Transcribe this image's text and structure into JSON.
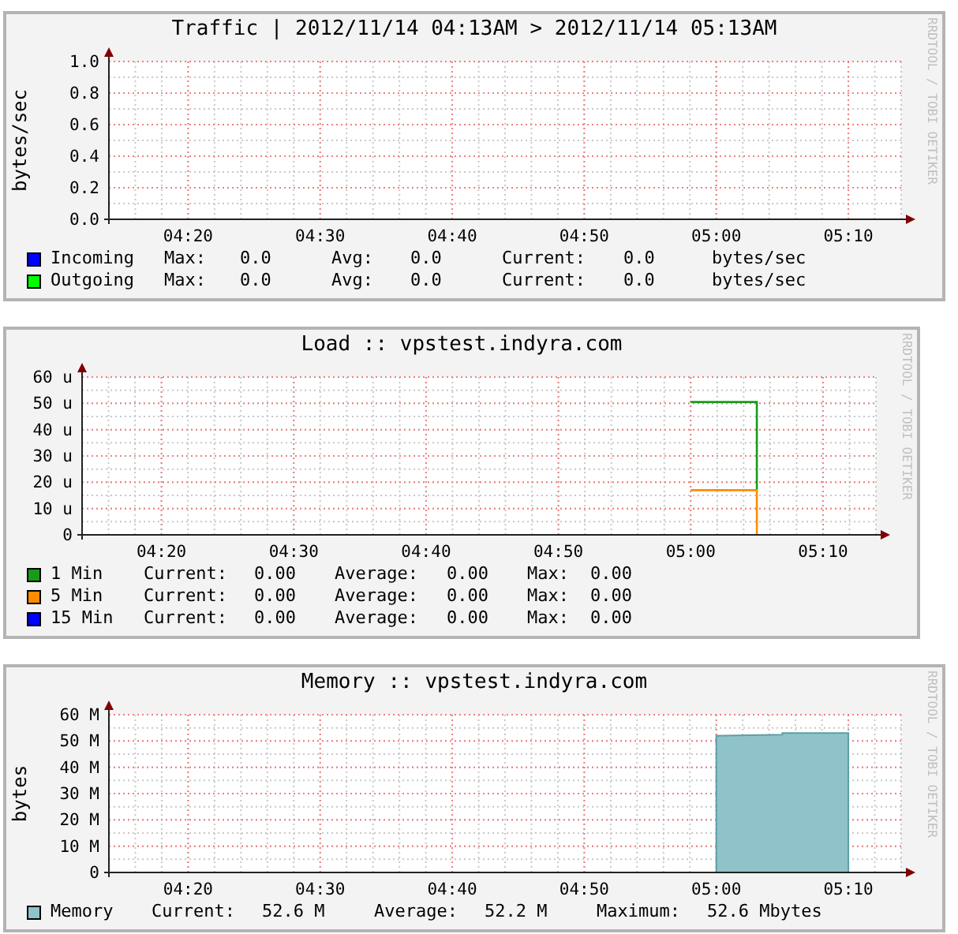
{
  "graphs": [
    {
      "title": "Traffic | 2012/11/14 04:13AM > 2012/11/14 05:13AM",
      "watermark": "RRDTOOL / TOBI OETIKER",
      "chart_data": {
        "type": "line",
        "ylabel": "bytes/sec",
        "grid": true,
        "xlim": [
          254,
          314
        ],
        "ylim": [
          0,
          1
        ],
        "xticks": [
          {
            "value": 260,
            "label": "04:20"
          },
          {
            "value": 270,
            "label": "04:30"
          },
          {
            "value": 280,
            "label": "04:40"
          },
          {
            "value": 290,
            "label": "04:50"
          },
          {
            "value": 300,
            "label": "05:00"
          },
          {
            "value": 310,
            "label": "05:10"
          }
        ],
        "yticks": [
          {
            "value": 0,
            "label": "0.0"
          },
          {
            "value": 0.2,
            "label": "0.2"
          },
          {
            "value": 0.4,
            "label": "0.4"
          },
          {
            "value": 0.6,
            "label": "0.6"
          },
          {
            "value": 0.8,
            "label": "0.8"
          },
          {
            "value": 1,
            "label": "1.0"
          }
        ]
      },
      "legend": [
        {
          "label": "Incoming",
          "color": "#0000ff",
          "fields": [
            {
              "label": "Max:",
              "value": "0.0"
            },
            {
              "label": "Avg:",
              "value": "0.0"
            },
            {
              "label": "Current:",
              "value": "0.0"
            }
          ],
          "unit": "bytes/sec"
        },
        {
          "label": "Outgoing",
          "color": "#00ff00",
          "fields": [
            {
              "label": "Max:",
              "value": "0.0"
            },
            {
              "label": "Avg:",
              "value": "0.0"
            },
            {
              "label": "Current:",
              "value": "0.0"
            }
          ],
          "unit": "bytes/sec"
        }
      ]
    },
    {
      "title": "Load :: vpstest.indyra.com",
      "watermark": "RRDTOOL / TOBI OETIKER",
      "chart_data": {
        "type": "line",
        "grid": true,
        "xlim": [
          254,
          314
        ],
        "ylim": [
          0,
          60
        ],
        "x": [
          300,
          305,
          305
        ],
        "series": [
          {
            "name": "1 Min",
            "color": "#1a9a1a",
            "values": [
              50.5,
              50.5,
              17
            ]
          },
          {
            "name": "5 Min",
            "color": "#ff8c00",
            "values": [
              17,
              17,
              0
            ]
          },
          {
            "name": "15 Min",
            "color": "#0000ff",
            "values": [
              null,
              null,
              null
            ]
          }
        ],
        "xticks": [
          {
            "value": 260,
            "label": "04:20"
          },
          {
            "value": 270,
            "label": "04:30"
          },
          {
            "value": 280,
            "label": "04:40"
          },
          {
            "value": 290,
            "label": "04:50"
          },
          {
            "value": 300,
            "label": "05:00"
          },
          {
            "value": 310,
            "label": "05:10"
          }
        ],
        "yticks": [
          {
            "value": 0,
            "label": "0"
          },
          {
            "value": 10,
            "label": "10 u"
          },
          {
            "value": 20,
            "label": "20 u"
          },
          {
            "value": 30,
            "label": "30 u"
          },
          {
            "value": 40,
            "label": "40 u"
          },
          {
            "value": 50,
            "label": "50 u"
          },
          {
            "value": 60,
            "label": "60 u"
          }
        ]
      },
      "legend": [
        {
          "fields": [
            {
              "label": "Current:",
              "value": "0.00"
            },
            {
              "label": "Average:",
              "value": "0.00"
            },
            {
              "label": "Max:",
              "value": "0.00"
            }
          ]
        },
        {
          "fields": [
            {
              "label": "Current:",
              "value": "0.00"
            },
            {
              "label": "Average:",
              "value": "0.00"
            },
            {
              "label": "Max:",
              "value": "0.00"
            }
          ]
        },
        {
          "fields": [
            {
              "label": "Current:",
              "value": "0.00"
            },
            {
              "label": "Average:",
              "value": "0.00"
            },
            {
              "label": "Max:",
              "value": "0.00"
            }
          ]
        }
      ]
    },
    {
      "title": "Memory :: vpstest.indyra.com",
      "watermark": "RRDTOOL / TOBI OETIKER",
      "chart_data": {
        "type": "area",
        "ylabel": "bytes",
        "grid": true,
        "xlim": [
          254,
          314
        ],
        "ylim": [
          0,
          60
        ],
        "x": [
          300,
          305,
          305,
          310
        ],
        "series": [
          {
            "name": "Memory",
            "color": "#8fc3c9",
            "values": [
              52,
              52.4,
              53,
              53
            ]
          }
        ],
        "xticks": [
          {
            "value": 260,
            "label": "04:20"
          },
          {
            "value": 270,
            "label": "04:30"
          },
          {
            "value": 280,
            "label": "04:40"
          },
          {
            "value": 290,
            "label": "04:50"
          },
          {
            "value": 300,
            "label": "05:00"
          },
          {
            "value": 310,
            "label": "05:10"
          }
        ],
        "yticks": [
          {
            "value": 0,
            "label": "0"
          },
          {
            "value": 10,
            "label": "10 M"
          },
          {
            "value": 20,
            "label": "20 M"
          },
          {
            "value": 30,
            "label": "30 M"
          },
          {
            "value": 40,
            "label": "40 M"
          },
          {
            "value": 50,
            "label": "50 M"
          },
          {
            "value": 60,
            "label": "60 M"
          }
        ]
      },
      "legend": [
        {
          "fields": [
            {
              "label": "Current:",
              "value": "52.6 M"
            },
            {
              "label": "Average:",
              "value": "52.2 M"
            },
            {
              "label": "Maximum:",
              "value": "52.6 Mbytes"
            }
          ]
        }
      ]
    }
  ]
}
